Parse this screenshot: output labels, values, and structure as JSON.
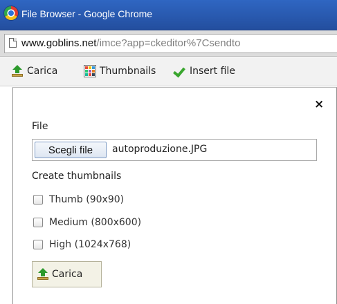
{
  "window": {
    "title": "File Browser - Google Chrome"
  },
  "address_bar": {
    "host": "www.goblins.net",
    "path": "/imce?app=ckeditor%7Csendto"
  },
  "toolbar": {
    "upload_label": "Carica",
    "thumbnails_label": "Thumbnails",
    "insert_label": "Insert file"
  },
  "upload_form": {
    "file_label": "File",
    "choose_file_label": "Scegli file",
    "selected_file": "autoproduzione.JPG",
    "thumbnails_heading": "Create thumbnails",
    "thumbnail_options": [
      {
        "label": "Thumb (90x90)",
        "checked": false
      },
      {
        "label": "Medium (800x600)",
        "checked": false
      },
      {
        "label": "High (1024x768)",
        "checked": false
      }
    ],
    "submit_label": "Carica",
    "close_glyph": "×"
  },
  "colors": {
    "title_bar": "#2858ad",
    "toolbar_bg": "#f2f2f2",
    "accent_green": "#2c9a2c",
    "submit_bg": "#f3f2e6"
  },
  "icons": [
    "chrome-icon",
    "page-icon",
    "upload-icon",
    "thumbnails-icon",
    "checkmark-icon",
    "close-icon"
  ]
}
